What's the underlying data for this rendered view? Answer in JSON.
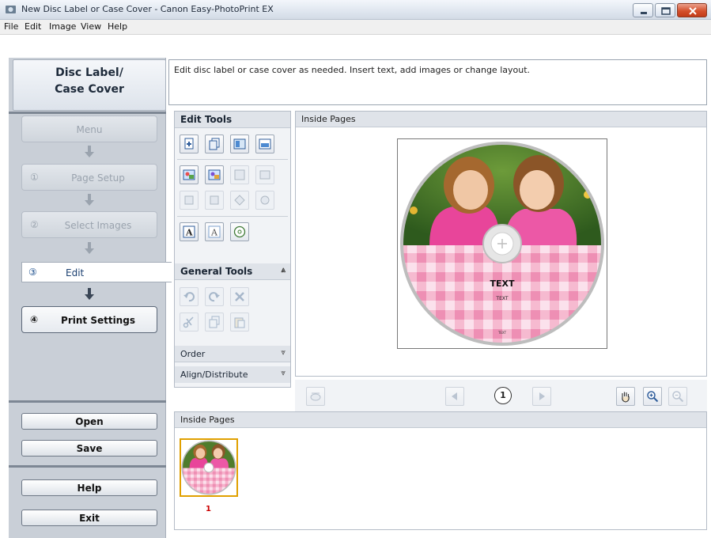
{
  "window": {
    "title": "New Disc Label or Case Cover - Canon Easy-PhotoPrint EX"
  },
  "menu": [
    "File",
    "Edit",
    "Image",
    "View",
    "Help"
  ],
  "sidebar": {
    "heading_line1": "Disc Label/",
    "heading_line2": "Case Cover",
    "steps": [
      {
        "label": "Menu",
        "num": ""
      },
      {
        "label": "Page Setup",
        "num": "①"
      },
      {
        "label": "Select Images",
        "num": "②"
      },
      {
        "label": "Edit",
        "num": "③",
        "active": true
      },
      {
        "label": "Print Settings",
        "num": "④"
      }
    ],
    "buttons": {
      "open": "Open",
      "save": "Save",
      "help": "Help",
      "exit": "Exit"
    }
  },
  "instructions": "Edit disc label or case cover as needed. Insert text, add images or change layout.",
  "tools": {
    "edit_tools": "Edit Tools",
    "general_tools": "General Tools",
    "order": "Order",
    "align": "Align/Distribute"
  },
  "canvas": {
    "header": "Inside Pages",
    "label_texts": {
      "t1": "TEXT",
      "t2": "TEXT",
      "t3": "TEXT"
    }
  },
  "navigation": {
    "page_number": "1"
  },
  "thumbnails": {
    "header": "Inside Pages",
    "items": [
      {
        "label": "1"
      }
    ]
  },
  "colors": {
    "accent": "#1a4d8c",
    "gingham_pink": "#f6b3cc",
    "thumb_highlight": "#e0a000"
  }
}
